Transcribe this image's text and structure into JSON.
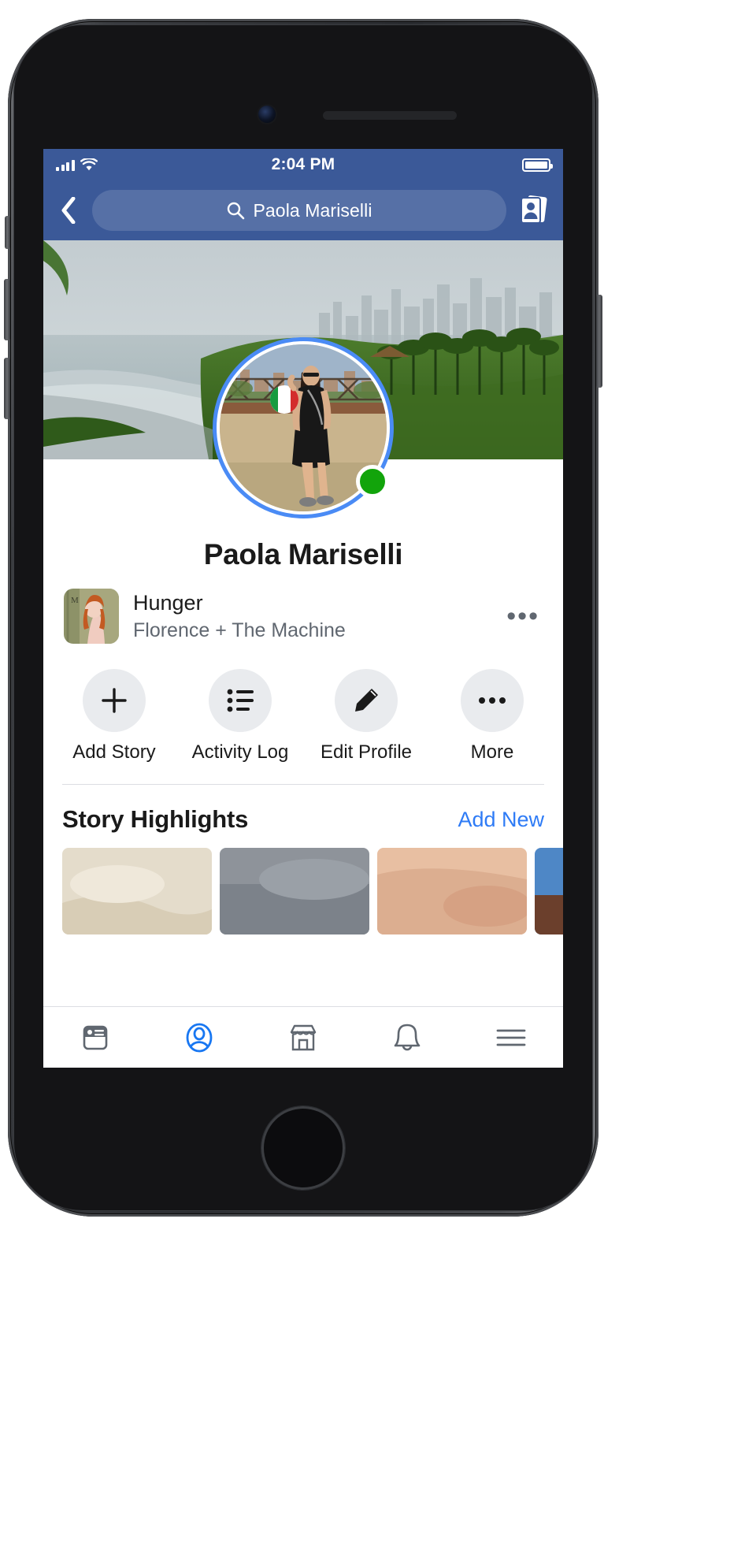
{
  "device": {
    "name": "iphone-8-frame",
    "home_button": "home-button"
  },
  "status_bar": {
    "time": "2:04 PM",
    "signal_icon": "cellular-signal-icon",
    "wifi_icon": "wifi-icon",
    "battery_icon": "battery-full-icon",
    "background_color": "#3b5998"
  },
  "nav_bar": {
    "back_icon": "back-chevron-icon",
    "search": {
      "icon": "search-icon",
      "value": "Paola Mariselli",
      "placeholder": "Search"
    },
    "friends_icon": "friend-requests-icon"
  },
  "cover": {
    "alt": "coastline-cover-photo"
  },
  "profile": {
    "avatar_alt": "profile-photo",
    "story_ring_color": "#4a8bf5",
    "online_status_color": "#12a40b",
    "name": "Paola Mariselli"
  },
  "music": {
    "album_art_alt": "album-artwork",
    "song": "Hunger",
    "artist": "Florence + The Machine",
    "more_label": "•••"
  },
  "actions": [
    {
      "icon": "plus-icon",
      "label": "Add Story"
    },
    {
      "icon": "list-icon",
      "label": "Activity Log"
    },
    {
      "icon": "pencil-icon",
      "label": "Edit Profile"
    },
    {
      "icon": "ellipsis-icon",
      "label": "More"
    }
  ],
  "highlights": {
    "title": "Story Highlights",
    "add_label": "Add New",
    "accent_color": "#2e7bf6",
    "cards": [
      {
        "alt": "highlight-beige"
      },
      {
        "alt": "highlight-gray"
      },
      {
        "alt": "highlight-skin"
      },
      {
        "alt": "highlight-blue"
      }
    ]
  },
  "tab_bar": {
    "active_color": "#1877f2",
    "inactive_color": "#606770",
    "items": [
      {
        "icon": "news-feed-icon",
        "active": false
      },
      {
        "icon": "profile-icon",
        "active": true
      },
      {
        "icon": "marketplace-icon",
        "active": false
      },
      {
        "icon": "notifications-bell-icon",
        "active": false
      },
      {
        "icon": "menu-hamburger-icon",
        "active": false
      }
    ]
  }
}
